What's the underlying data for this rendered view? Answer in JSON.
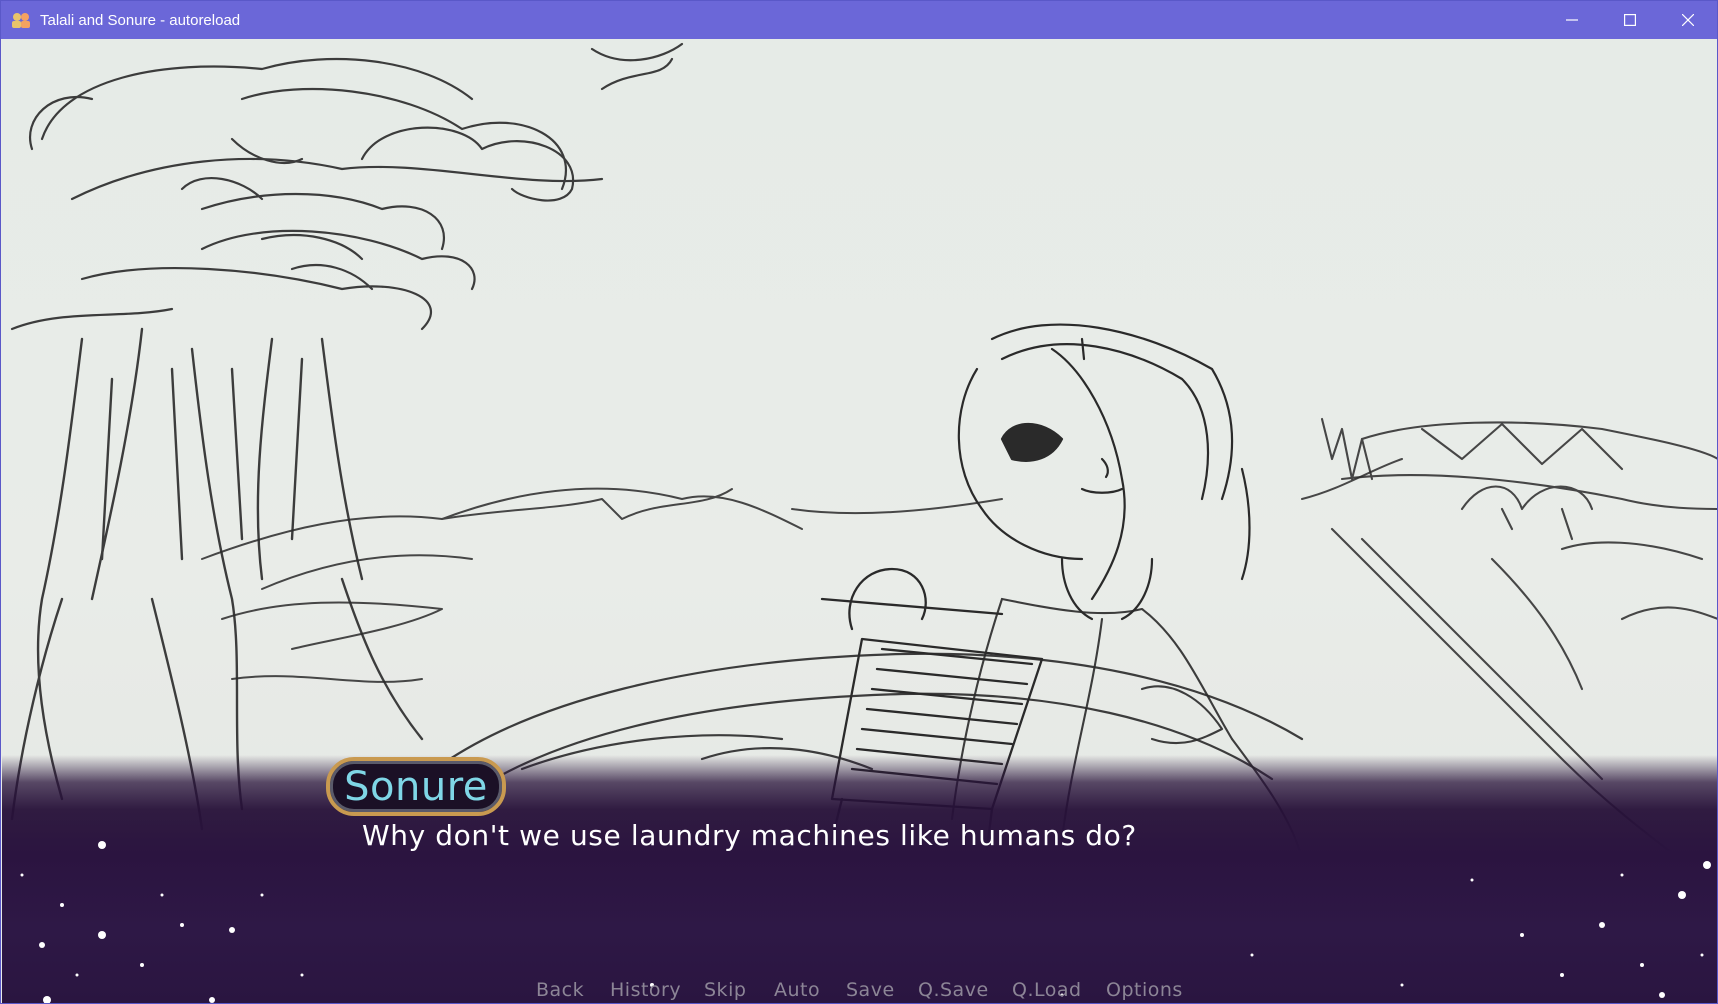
{
  "window": {
    "title": "Talali and Sonure - autoreload",
    "icon": "app-icon",
    "controls": [
      "minimize-icon",
      "maximize-icon",
      "close-icon"
    ]
  },
  "dialogue": {
    "speaker": "Sonure",
    "text": "Why don't we use laundry machines like humans do?"
  },
  "quick_menu": {
    "items": [
      "Back",
      "History",
      "Skip",
      "Auto",
      "Save",
      "Q.Save",
      "Q.Load",
      "Options"
    ]
  },
  "colors": {
    "titlebar": "#6b67d8",
    "speaker_name": "#7fd6e6",
    "namebox_border": "#c99a50",
    "quick_menu_text": "#8c8596",
    "panel": "#2b1440"
  }
}
